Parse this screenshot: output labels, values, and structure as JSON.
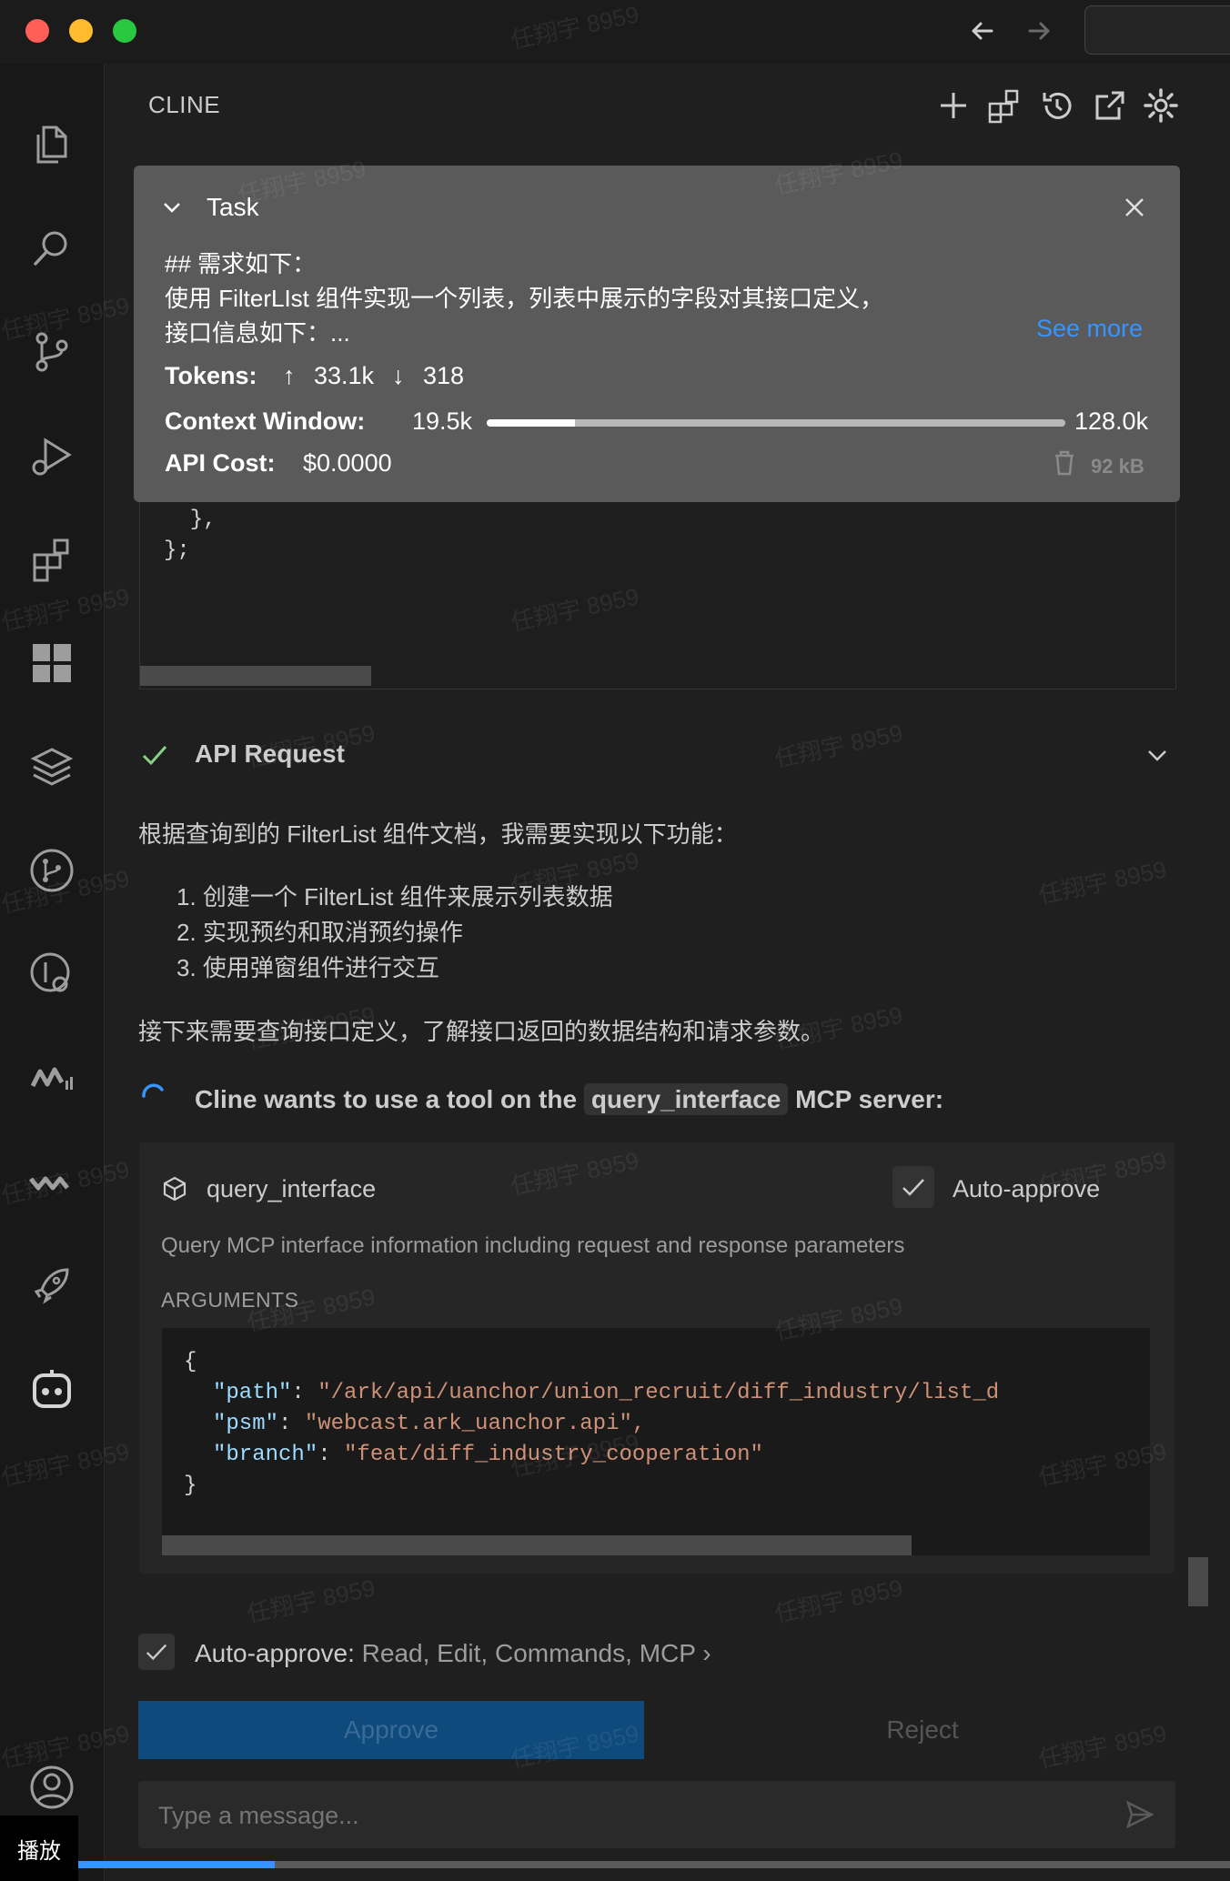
{
  "window": {
    "traffic_lights": {
      "close": "#ff5f57",
      "minimize": "#febc2e",
      "zoom": "#28c840"
    }
  },
  "panel": {
    "title": "CLINE",
    "header_icons": [
      "plus-icon",
      "mcp-servers-icon",
      "history-icon",
      "popout-icon",
      "gear-icon"
    ]
  },
  "task": {
    "label": "Task",
    "text_line1": "## 需求如下：",
    "text_line2": "使用 FilterLIst 组件实现一个列表，列表中展示的字段对其接口定义，",
    "text_line3": "接口信息如下：...",
    "see_more": "See more",
    "tokens_label": "Tokens:",
    "tokens_up": "33.1k",
    "tokens_down": "318",
    "context_label": "Context Window:",
    "context_used": "19.5k",
    "context_max": "128.0k",
    "context_fraction": 0.152,
    "cost_label": "API Cost:",
    "cost_value": "$0.0000",
    "size": "92 kB"
  },
  "code_tail": {
    "line1": "  },",
    "line2": "};"
  },
  "api_request": {
    "label": "API Request",
    "intro": "根据查询到的 FilterList 组件文档，我需要实现以下功能：",
    "items": [
      "创建一个 FilterList 组件来展示列表数据",
      "实现预约和取消预约操作",
      "使用弹窗组件进行交互"
    ],
    "followup": "接下来需要查询接口定义，了解接口返回的数据结构和请求参数。"
  },
  "tool_request": {
    "prefix": "Cline wants to use a tool on the",
    "server": "query_interface",
    "suffix": "MCP server:",
    "tool_name": "query_interface",
    "auto_approve": "Auto-approve",
    "description": "Query MCP interface information including request and response parameters",
    "arguments_label": "ARGUMENTS",
    "args": {
      "open": "{",
      "path_key": "\"path\"",
      "path_val": "\"/ark/api/uanchor/union_recruit/diff_industry/list_d",
      "psm_key": "\"psm\"",
      "psm_val": "\"webcast.ark_uanchor.api\",",
      "branch_key": "\"branch\"",
      "branch_val": "\"feat/diff_industry_cooperation\"",
      "close": "}"
    }
  },
  "auto_approve_bar": {
    "label": "Auto-approve:",
    "value": "Read, Edit, Commands, MCP"
  },
  "buttons": {
    "approve": "Approve",
    "reject": "Reject"
  },
  "input": {
    "placeholder": "Type a message..."
  },
  "overlay": {
    "play_label": "播放",
    "watermark": "任翔宇 8959"
  },
  "colors": {
    "accent_blue": "#3794ff",
    "check_green": "#89d185",
    "approve_bg": "#0e4a7b"
  }
}
